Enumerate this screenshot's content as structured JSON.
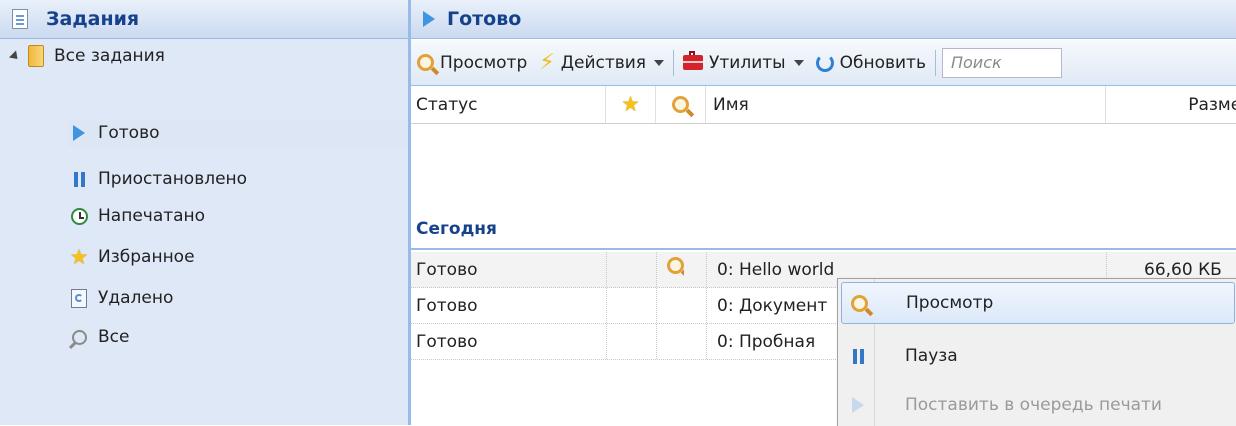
{
  "left_panel": {
    "title": "Задания",
    "root": "Все задания",
    "items": [
      {
        "label": "Готово",
        "icon": "play-icon"
      },
      {
        "label": "Приостановлено",
        "icon": "pause-icon"
      },
      {
        "label": "Напечатано",
        "icon": "printed-icon"
      },
      {
        "label": "Избранное",
        "icon": "star-icon"
      },
      {
        "label": "Удалено",
        "icon": "trash-icon"
      },
      {
        "label": "Все",
        "icon": "magnify-icon"
      }
    ]
  },
  "right_panel": {
    "title": "Готово",
    "toolbar": {
      "view": "Просмотр",
      "actions": "Действия",
      "utilities": "Утилиты",
      "refresh": "Обновить",
      "search_placeholder": "Поиск"
    },
    "columns": {
      "status": "Статус",
      "name": "Имя",
      "size": "Размер"
    },
    "group": "Сегодня",
    "rows": [
      {
        "status": "Готово",
        "name": "0: Hello world",
        "size": "66,60 КБ",
        "has_preview": true
      },
      {
        "status": "Готово",
        "name": "0: Документ",
        "size": "",
        "has_preview": false
      },
      {
        "status": "Готово",
        "name": "0: Пробная",
        "size": "",
        "has_preview": false
      }
    ]
  },
  "context_menu": {
    "items": [
      {
        "label": "Просмотр",
        "icon": "preview-icon",
        "state": "hover"
      },
      {
        "label": "Пауза",
        "icon": "pause-icon",
        "state": "enabled"
      },
      {
        "label": "Поставить в очередь печати",
        "icon": "play-icon",
        "state": "disabled"
      }
    ]
  },
  "colors": {
    "header_text": "#15428b",
    "panel_bg": "#dfe8f6",
    "border": "#99bbe8"
  }
}
